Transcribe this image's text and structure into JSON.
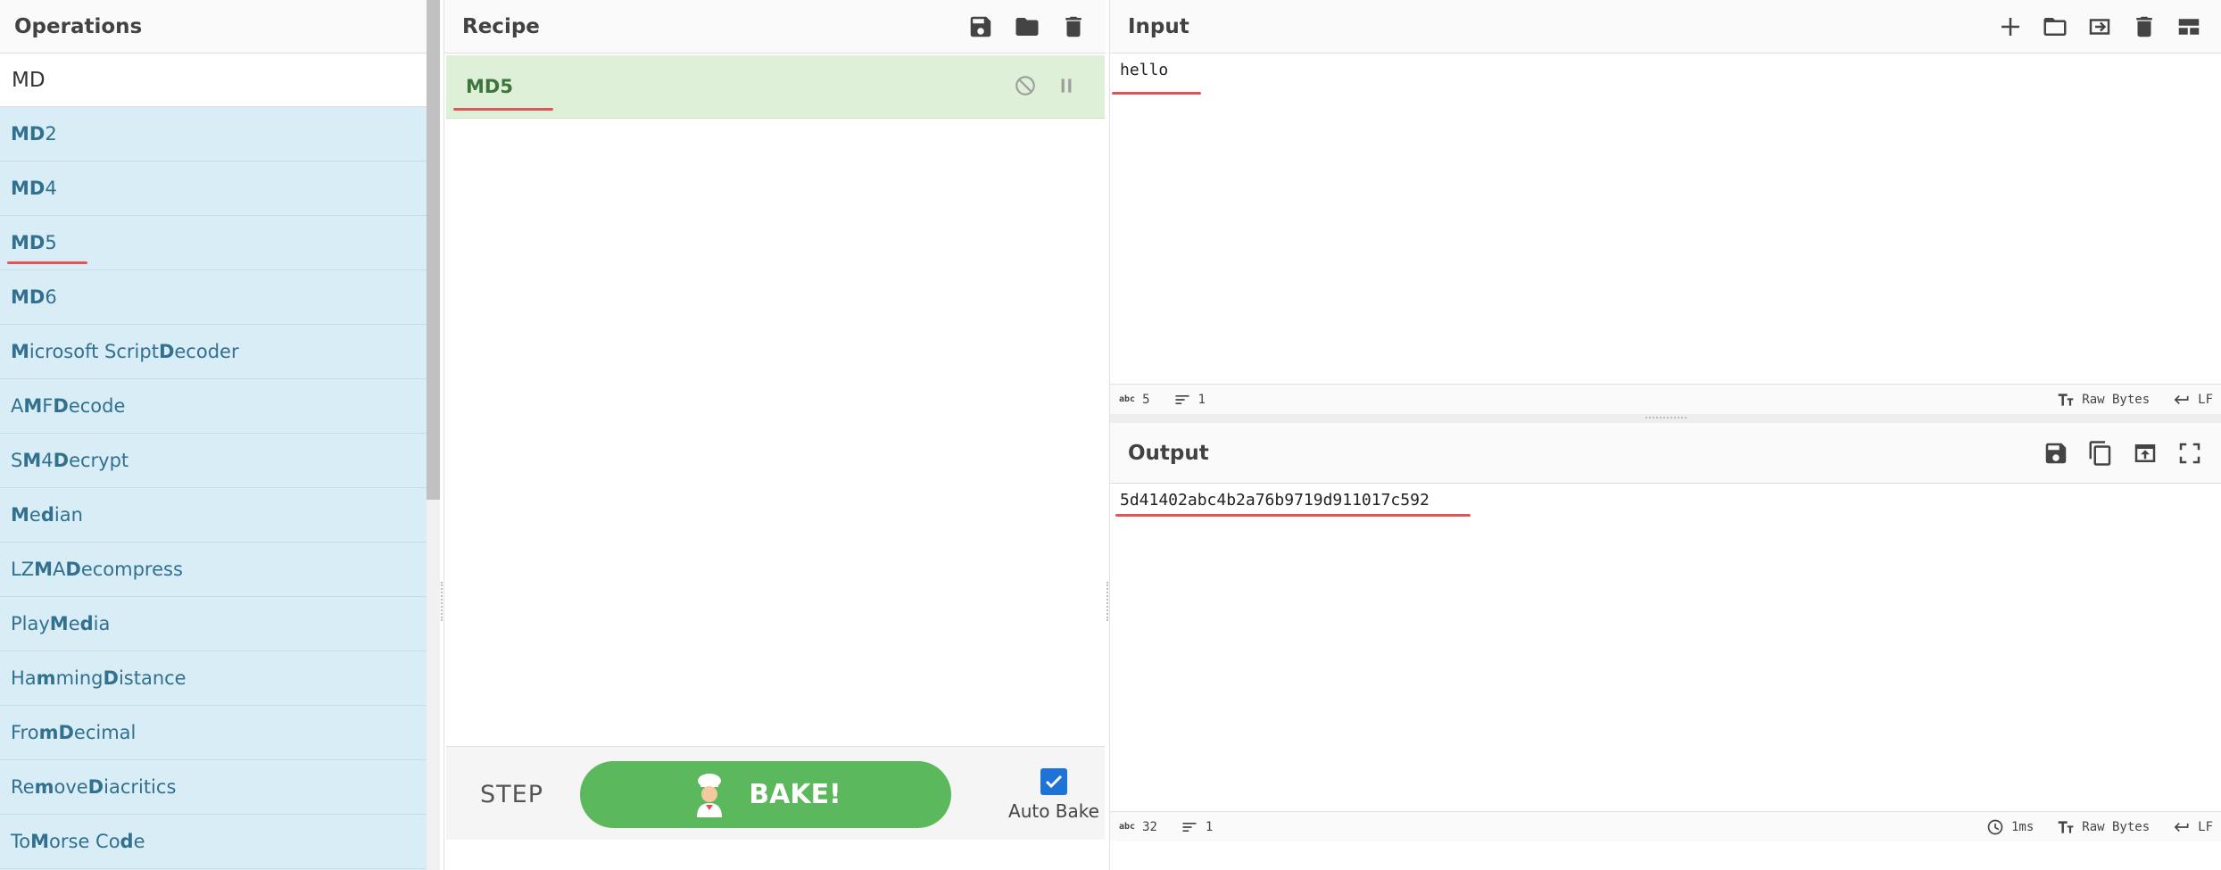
{
  "operations": {
    "title": "Operations",
    "search_value": "MD",
    "items": [
      {
        "parts": [
          [
            "MD",
            true
          ],
          [
            "2",
            false
          ]
        ]
      },
      {
        "parts": [
          [
            "MD",
            true
          ],
          [
            "4",
            false
          ]
        ]
      },
      {
        "parts": [
          [
            "MD",
            true
          ],
          [
            "5",
            false
          ]
        ]
      },
      {
        "parts": [
          [
            "MD",
            true
          ],
          [
            "6",
            false
          ]
        ]
      },
      {
        "parts": [
          [
            "M",
            true
          ],
          [
            "icrosoft Script ",
            false
          ],
          [
            "D",
            true
          ],
          [
            "ecoder",
            false
          ]
        ]
      },
      {
        "parts": [
          [
            "A",
            false
          ],
          [
            "M",
            true
          ],
          [
            "F ",
            false
          ],
          [
            "D",
            true
          ],
          [
            "ecode",
            false
          ]
        ]
      },
      {
        "parts": [
          [
            "S",
            false
          ],
          [
            "M",
            true
          ],
          [
            "4 ",
            false
          ],
          [
            "D",
            true
          ],
          [
            "ecrypt",
            false
          ]
        ]
      },
      {
        "parts": [
          [
            "M",
            true
          ],
          [
            "e",
            false
          ],
          [
            "d",
            true
          ],
          [
            "ian",
            false
          ]
        ]
      },
      {
        "parts": [
          [
            "LZ",
            false
          ],
          [
            "M",
            true
          ],
          [
            "A ",
            false
          ],
          [
            "D",
            true
          ],
          [
            "ecompress",
            false
          ]
        ]
      },
      {
        "parts": [
          [
            "Play ",
            false
          ],
          [
            "M",
            true
          ],
          [
            "e",
            false
          ],
          [
            "d",
            true
          ],
          [
            "ia",
            false
          ]
        ]
      },
      {
        "parts": [
          [
            "Ha",
            false
          ],
          [
            "m",
            true
          ],
          [
            "ming ",
            false
          ],
          [
            "D",
            true
          ],
          [
            "istance",
            false
          ]
        ]
      },
      {
        "parts": [
          [
            "Fro",
            false
          ],
          [
            "m",
            true
          ],
          [
            " ",
            false
          ],
          [
            "D",
            true
          ],
          [
            "ecimal",
            false
          ]
        ]
      },
      {
        "parts": [
          [
            "Re",
            false
          ],
          [
            "m",
            true
          ],
          [
            "ove ",
            false
          ],
          [
            "D",
            true
          ],
          [
            "iacritics",
            false
          ]
        ]
      },
      {
        "parts": [
          [
            "To ",
            false
          ],
          [
            "M",
            true
          ],
          [
            "orse Co",
            false
          ],
          [
            "d",
            true
          ],
          [
            "e",
            false
          ]
        ]
      }
    ]
  },
  "recipe": {
    "title": "Recipe",
    "icons": [
      "save-icon",
      "folder-icon",
      "trash-icon"
    ],
    "operation": {
      "name": "MD5",
      "controls": [
        "disable-icon",
        "pause-icon"
      ]
    },
    "step_label": "STEP",
    "bake_label": "BAKE!",
    "auto_bake_label": "Auto Bake",
    "auto_bake_checked": true
  },
  "input": {
    "title": "Input",
    "icons": [
      "plus-icon",
      "folder-icon",
      "import-icon",
      "trash-icon",
      "layout-icon"
    ],
    "value": "hello",
    "status": {
      "length": "5",
      "lines": "1",
      "encoding": "Raw Bytes",
      "eol": "LF"
    }
  },
  "output": {
    "title": "Output",
    "icons": [
      "save-icon",
      "copy-icon",
      "open-icon",
      "maximize-icon"
    ],
    "value": "5d41402abc4b2a76b9719d911017c592",
    "status": {
      "length": "32",
      "lines": "1",
      "time": "1ms",
      "encoding": "Raw Bytes",
      "eol": "LF"
    }
  },
  "colors": {
    "highlight_underline": "#e05555",
    "bake_green": "#5cb85c",
    "ops_bg": "#d9edf7",
    "recipe_op_bg": "#dff0d8"
  }
}
